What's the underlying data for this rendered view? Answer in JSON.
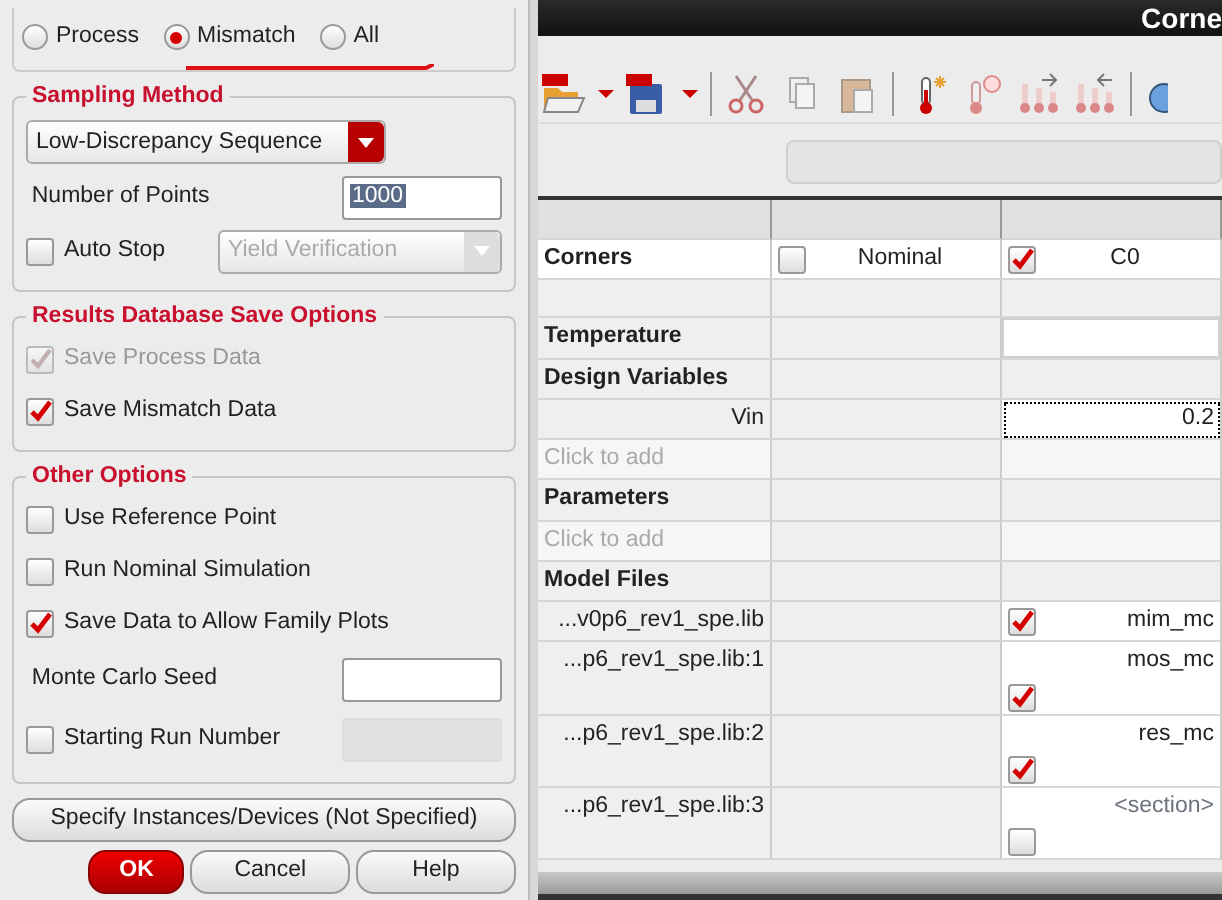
{
  "monte_carlo_dialog": {
    "variation_options": [
      {
        "label": "Process",
        "selected": false
      },
      {
        "label": "Mismatch",
        "selected": true
      },
      {
        "label": "All",
        "selected": false
      }
    ],
    "sampling_method": {
      "title": "Sampling Method",
      "method": "Low-Discrepancy Sequence",
      "points_label": "Number of Points",
      "points_value": "1000",
      "auto_stop": {
        "label": "Auto Stop",
        "checked": false
      },
      "stop_method": "Yield Verification"
    },
    "save_options": {
      "title": "Results Database Save Options",
      "items": [
        {
          "label": "Save Process Data",
          "checked": true,
          "disabled": true
        },
        {
          "label": "Save Mismatch Data",
          "checked": true,
          "disabled": false
        }
      ]
    },
    "other_options": {
      "title": "Other Options",
      "items": [
        {
          "kind": "checkbox",
          "label": "Use Reference Point",
          "checked": false
        },
        {
          "kind": "checkbox",
          "label": "Run Nominal Simulation",
          "checked": false
        },
        {
          "kind": "checkbox",
          "label": "Save Data to Allow Family Plots",
          "checked": true
        },
        {
          "kind": "field",
          "label": "Monte Carlo Seed"
        },
        {
          "kind": "checkbox_field",
          "label": "Starting Run Number",
          "checked": false
        }
      ]
    },
    "specify_button": "Specify Instances/Devices (Not Specified)",
    "buttons": [
      {
        "label": "OK",
        "default": true
      },
      {
        "label": "Cancel",
        "default": false
      },
      {
        "label": "Help",
        "default": false
      }
    ]
  },
  "corners_window": {
    "title": "Corne",
    "table": {
      "rows": [
        {
          "kind": "corners",
          "label": "Corners",
          "corners": [
            {
              "name": "Nominal",
              "checked": false
            },
            {
              "name": "C0",
              "checked": true
            }
          ]
        },
        {
          "kind": "blank"
        },
        {
          "kind": "section",
          "label": "Temperature",
          "editable": true
        },
        {
          "kind": "section",
          "label": "Design Variables",
          "editable": false
        },
        {
          "kind": "variable",
          "label": "Vin",
          "value": "0.2"
        },
        {
          "kind": "add",
          "placeholder": "Click to add"
        },
        {
          "kind": "section",
          "label": "Parameters",
          "editable": false
        },
        {
          "kind": "add",
          "placeholder": "Click to add"
        },
        {
          "kind": "section",
          "label": "Model Files",
          "editable": false
        },
        {
          "kind": "model_file",
          "label": "...v0p6_rev1_spe.lib",
          "checked": true,
          "section": "mim_mc"
        },
        {
          "kind": "model_file",
          "label": "...p6_rev1_spe.lib:1",
          "checked": true,
          "section": "mos_mc"
        },
        {
          "kind": "model_file",
          "label": "...p6_rev1_spe.lib:2",
          "checked": true,
          "section": "res_mc"
        },
        {
          "kind": "model_file",
          "label": "...p6_rev1_spe.lib:3",
          "checked": false,
          "placeholder": "<section>"
        }
      ]
    }
  }
}
